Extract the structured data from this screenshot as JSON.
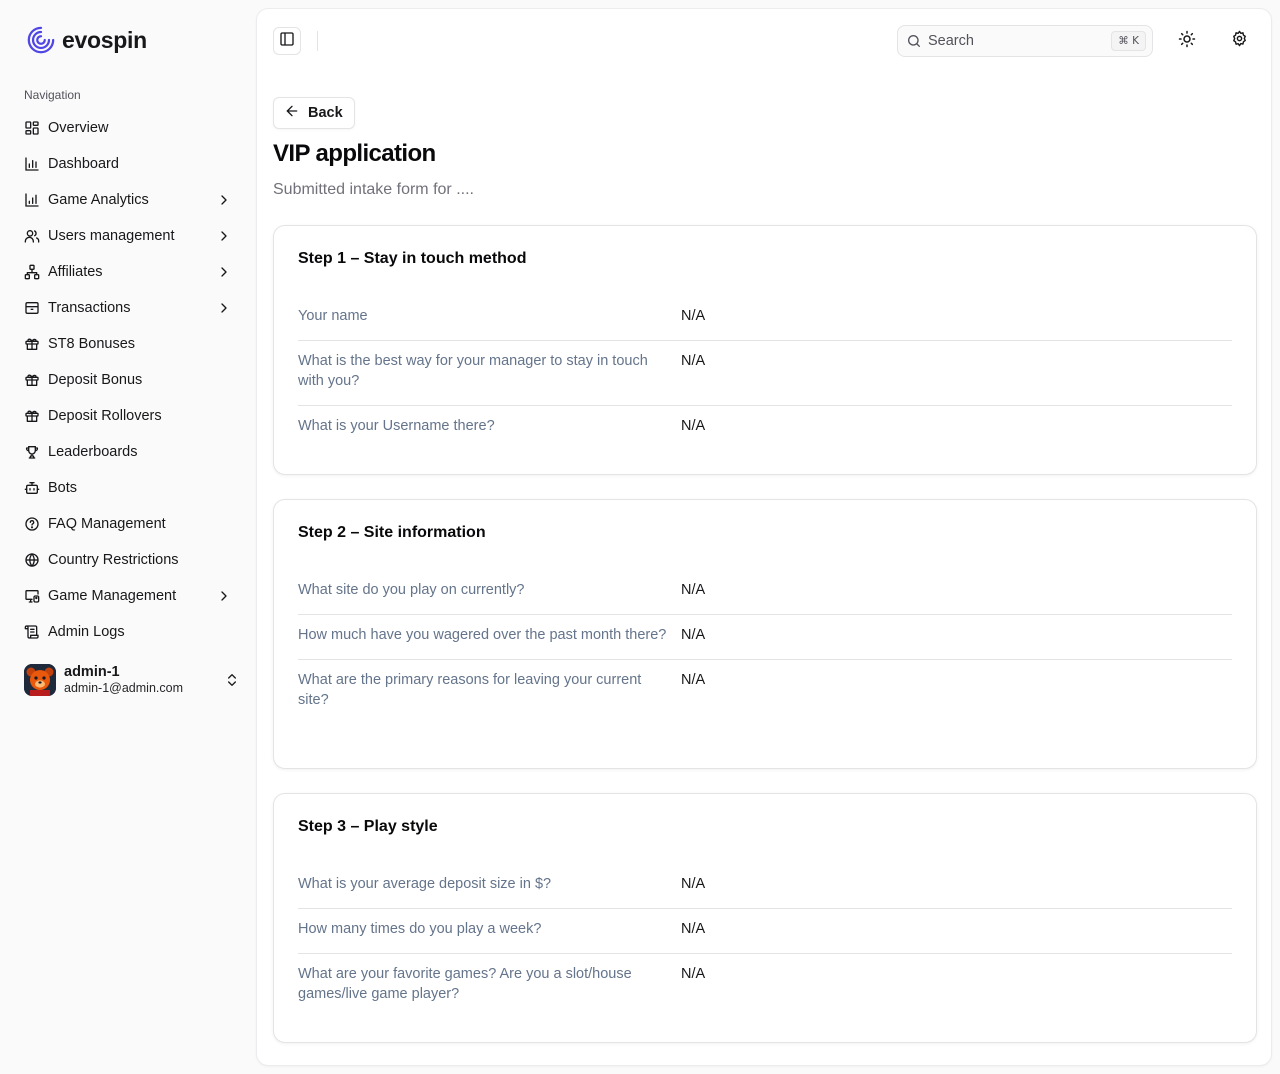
{
  "brand": {
    "name": "evospin"
  },
  "sidebar": {
    "group_label": "Navigation",
    "items": [
      {
        "label": "Overview",
        "icon": "layout-grid-icon",
        "has_submenu": false
      },
      {
        "label": "Dashboard",
        "icon": "bar-chart-icon",
        "has_submenu": false
      },
      {
        "label": "Game Analytics",
        "icon": "bar-chart-icon",
        "has_submenu": true
      },
      {
        "label": "Users management",
        "icon": "users-icon",
        "has_submenu": true
      },
      {
        "label": "Affiliates",
        "icon": "network-icon",
        "has_submenu": true
      },
      {
        "label": "Transactions",
        "icon": "archive-icon",
        "has_submenu": true
      },
      {
        "label": "ST8 Bonuses",
        "icon": "gift-icon",
        "has_submenu": false
      },
      {
        "label": "Deposit Bonus",
        "icon": "gift-icon",
        "has_submenu": false
      },
      {
        "label": "Deposit Rollovers",
        "icon": "gift-icon",
        "has_submenu": false
      },
      {
        "label": "Leaderboards",
        "icon": "trophy-icon",
        "has_submenu": false
      },
      {
        "label": "Bots",
        "icon": "bot-icon",
        "has_submenu": false
      },
      {
        "label": "FAQ Management",
        "icon": "help-circle-icon",
        "has_submenu": false
      },
      {
        "label": "Country Restrictions",
        "icon": "globe-icon",
        "has_submenu": false
      },
      {
        "label": "Game Management",
        "icon": "monitor-gamepad-icon",
        "has_submenu": true
      },
      {
        "label": "Admin Logs",
        "icon": "scroll-text-icon",
        "has_submenu": false
      }
    ],
    "user": {
      "name": "admin-1",
      "email": "admin-1@admin.com"
    }
  },
  "topbar": {
    "search_placeholder": "Search",
    "search_shortcut": "⌘ K"
  },
  "page": {
    "back_label": "Back",
    "title": "VIP application",
    "subtitle": "Submitted intake form for ...."
  },
  "steps": [
    {
      "title": "Step 1 – Stay in touch method",
      "rows": [
        {
          "question": "Your name",
          "answer": "N/A"
        },
        {
          "question": "What is the best way for your manager to stay in touch with you?",
          "answer": "N/A"
        },
        {
          "question": "What is your Username there?",
          "answer": "N/A"
        }
      ]
    },
    {
      "title": "Step 2 – Site information",
      "rows": [
        {
          "question": "What site do you play on currently?",
          "answer": "N/A"
        },
        {
          "question": "How much have you wagered over the past month there?",
          "answer": "N/A"
        },
        {
          "question": "What are the primary reasons for leaving your current site?",
          "answer": "N/A"
        }
      ]
    },
    {
      "title": "Step 3 – Play style",
      "rows": [
        {
          "question": "What is your average deposit size in $?",
          "answer": "N/A"
        },
        {
          "question": "How many times do you play a week?",
          "answer": "N/A"
        },
        {
          "question": "What are your favorite games? Are you a slot/house games/live game player?",
          "answer": "N/A"
        }
      ]
    }
  ],
  "colors": {
    "brand_accent": "#4f46e5",
    "muted_text": "#64748b",
    "border": "#e4e4e7"
  }
}
